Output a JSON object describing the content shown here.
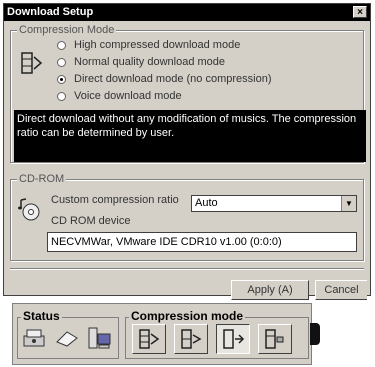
{
  "dialog": {
    "title": "Download Setup",
    "close_label": "×",
    "compression_group": {
      "label": "Compression Mode",
      "options": [
        {
          "label": "High compressed download mode",
          "checked": false
        },
        {
          "label": "Normal quality download mode",
          "checked": false
        },
        {
          "label": "Direct download mode (no compression)",
          "checked": true
        },
        {
          "label": "Voice download mode",
          "checked": false
        }
      ],
      "description": "Direct download without any modification of musics. The compression ratio can be determined by user."
    },
    "cdrom_group": {
      "label": "CD-ROM",
      "ratio_label": "Custom compression ratio",
      "ratio_value": "Auto",
      "device_label": "CD ROM device",
      "device_value": "NECVMWar, VMware IDE CDR10 v1.00 (0:0:0)"
    },
    "apply_label": "Apply (A)",
    "cancel_label": "Cancel"
  },
  "toolbar": {
    "status_label": "Status",
    "compression_label": "Compression mode",
    "status_icons": [
      "device-icon",
      "card-icon",
      "computer-icon"
    ],
    "mode_buttons": [
      {
        "icon": "mode-high-icon",
        "active": false
      },
      {
        "icon": "mode-normal-icon",
        "active": false
      },
      {
        "icon": "mode-direct-icon",
        "active": true
      },
      {
        "icon": "mode-voice-icon",
        "active": false
      }
    ]
  }
}
